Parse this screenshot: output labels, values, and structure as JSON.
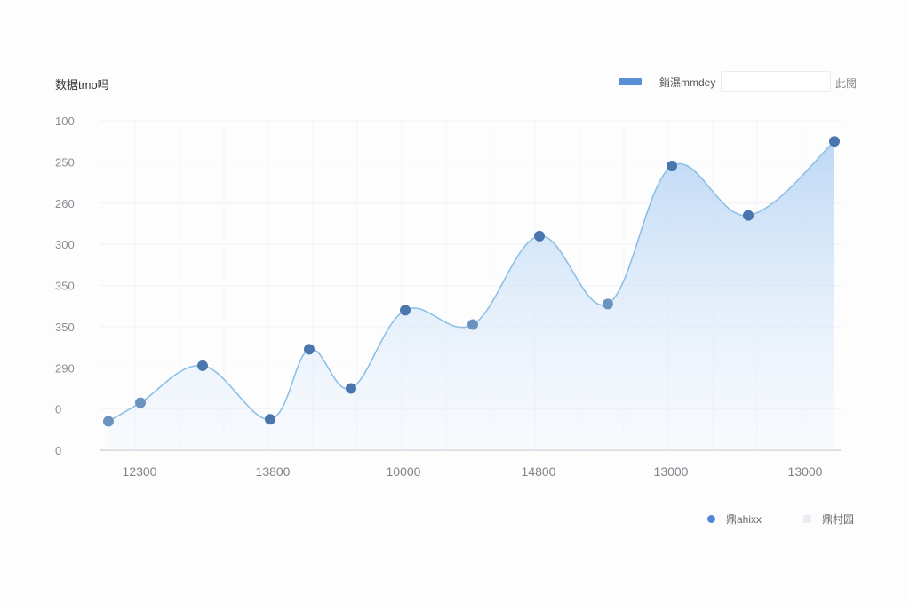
{
  "chart_data": {
    "type": "area",
    "title": "数据tmo吗",
    "y_ticks": [
      "100",
      "250",
      "260",
      "300",
      "350",
      "350",
      "290",
      "0",
      "0"
    ],
    "x_ticks": [
      "12300",
      "13800",
      "10000",
      "14800",
      "13000",
      "13000"
    ],
    "series": [
      {
        "name": "銷濕mmdey",
        "color": "#5a8fd6",
        "values": [
          0.7,
          1.15,
          2.05,
          0.75,
          2.45,
          1.5,
          3.4,
          3.05,
          5.2,
          3.55,
          6.9,
          5.7,
          7.5
        ]
      }
    ],
    "point_shades": [
      "light",
      "light",
      "dark",
      "dark",
      "dark",
      "dark",
      "dark",
      "light",
      "dark",
      "light",
      "dark",
      "dark",
      "dark"
    ],
    "grid": true,
    "legend_position": "top-right"
  },
  "legend_top": {
    "label": "銷濕mmdey",
    "action": "此閱"
  },
  "bottom_legend": [
    {
      "label": "鼎ahixx",
      "color": "#4f86d8"
    },
    {
      "label": "鼎村园",
      "color": "#e9edf1"
    }
  ]
}
